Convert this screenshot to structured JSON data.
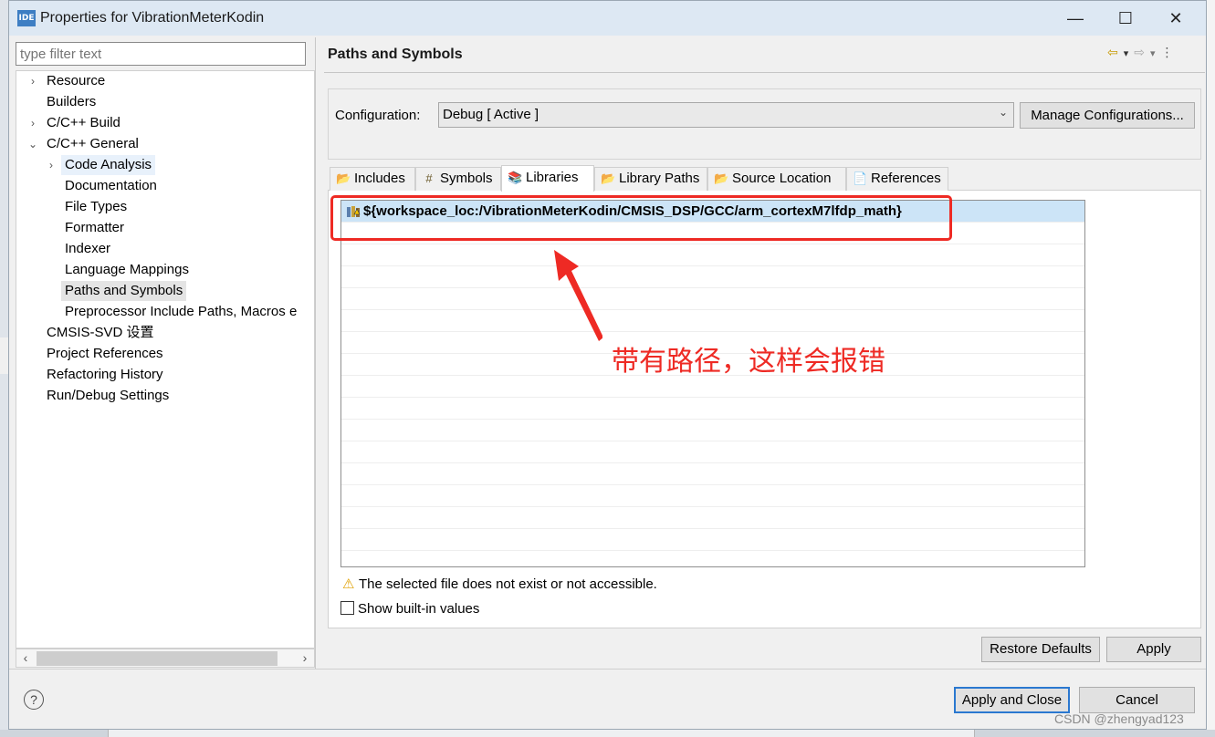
{
  "window": {
    "app_icon": "IDE",
    "title": "Properties for VibrationMeterKodin",
    "minimize_icon": "—",
    "maximize_icon": "☐",
    "close_icon": "✕"
  },
  "sidebar": {
    "filter_placeholder": "type filter text",
    "items": [
      {
        "label": "Resource",
        "twisty": "›",
        "level": 0
      },
      {
        "label": "Builders",
        "twisty": "",
        "level": 0
      },
      {
        "label": "C/C++ Build",
        "twisty": "›",
        "level": 0
      },
      {
        "label": "C/C++ General",
        "twisty": "⌄",
        "level": 0
      },
      {
        "label": "Code Analysis",
        "twisty": "›",
        "level": 1
      },
      {
        "label": "Documentation",
        "twisty": "",
        "level": 1
      },
      {
        "label": "File Types",
        "twisty": "",
        "level": 1
      },
      {
        "label": "Formatter",
        "twisty": "",
        "level": 1
      },
      {
        "label": "Indexer",
        "twisty": "",
        "level": 1
      },
      {
        "label": "Language Mappings",
        "twisty": "",
        "level": 1
      },
      {
        "label": "Paths and Symbols",
        "twisty": "",
        "level": 1
      },
      {
        "label": "Preprocessor Include Paths, Macros e",
        "twisty": "",
        "level": 1
      },
      {
        "label": "CMSIS-SVD 设置",
        "twisty": "",
        "level": 0
      },
      {
        "label": "Project References",
        "twisty": "",
        "level": 0
      },
      {
        "label": "Refactoring History",
        "twisty": "",
        "level": 0
      },
      {
        "label": "Run/Debug Settings",
        "twisty": "",
        "level": 0
      }
    ],
    "selected": "Paths and Symbols",
    "scroll_left": "‹",
    "scroll_right": "›"
  },
  "page": {
    "title": "Paths and Symbols",
    "nav": {
      "back": "⇦",
      "back_menu": "▾",
      "forward": "⇨",
      "forward_menu": "▾",
      "more": "⋮"
    }
  },
  "config": {
    "label": "Configuration:",
    "value": "Debug  [ Active ]",
    "chevron": "⌄",
    "manage_button": "Manage Configurations..."
  },
  "tabs": [
    {
      "label": "Includes",
      "icon": "📂"
    },
    {
      "label": "Symbols",
      "icon": "#"
    },
    {
      "label": "Libraries",
      "icon": "📚"
    },
    {
      "label": "Library Paths",
      "icon": "📂"
    },
    {
      "label": "Source Location",
      "icon": "📂"
    },
    {
      "label": "References",
      "icon": "📄"
    }
  ],
  "active_tab": "Libraries",
  "libraries": {
    "entries": [
      "${workspace_loc:/VibrationMeterKodin/CMSIS_DSP/GCC/arm_cortexM7lfdp_math}"
    ],
    "warning_icon": "⚠",
    "warning": "The selected file does not exist or not accessible.",
    "show_builtin_label": "Show built-in values"
  },
  "annotation": {
    "text": "带有路径，这样会报错",
    "color": "#ee2a24"
  },
  "buttons": {
    "restore_defaults": "Restore Defaults",
    "apply": "Apply",
    "apply_and_close": "Apply and Close",
    "cancel": "Cancel",
    "help_icon": "?"
  },
  "watermark": "CSDN @zhengyad123"
}
